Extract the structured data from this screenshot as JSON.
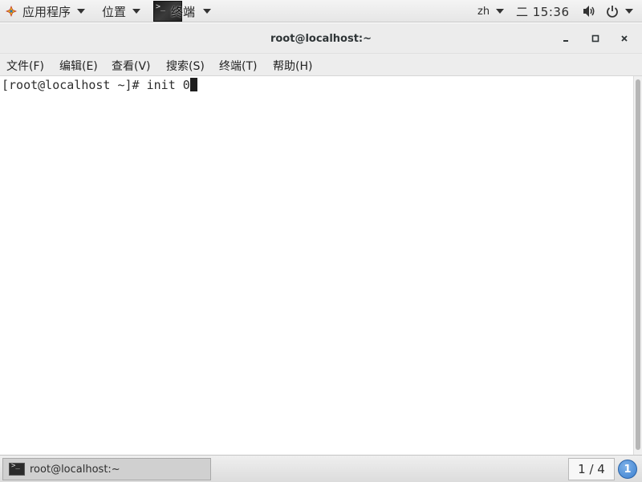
{
  "top_panel": {
    "applications_label": "应用程序",
    "places_label": "位置",
    "terminal_app_label": "终端",
    "terminal_thumb_text": ">_",
    "language": "zh",
    "clock": "二 15:36"
  },
  "window": {
    "title": "root@localhost:~"
  },
  "menu": {
    "items": [
      {
        "label": "文件(F)"
      },
      {
        "label": "编辑(E)"
      },
      {
        "label": "查看(V)"
      },
      {
        "label": "搜索(S)"
      },
      {
        "label": "终端(T)"
      },
      {
        "label": "帮助(H)"
      }
    ]
  },
  "terminal": {
    "prompt": "[root@localhost ~]# ",
    "command": "init 0"
  },
  "bottom_panel": {
    "task_label": "root@localhost:~",
    "task_icon_text": ">_",
    "workspace": "1 / 4",
    "notification_count": "1"
  },
  "colors": {
    "notification_badge": "#3a7fd0",
    "terminal_background": "#ffffff"
  }
}
